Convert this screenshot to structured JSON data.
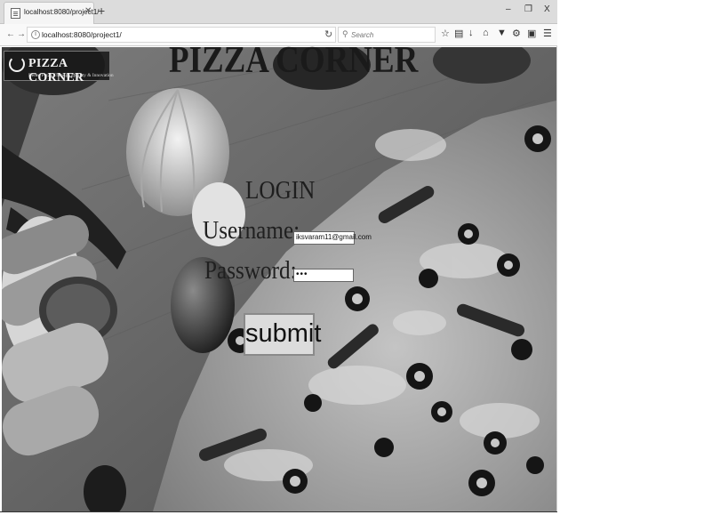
{
  "browser": {
    "tab_title": "localhost:8080/project1/",
    "tab_close": "✕",
    "new_tab": "+",
    "window_controls": {
      "minimize": "–",
      "restore": "❐",
      "close": "X"
    },
    "url": "localhost:8080/project1/",
    "search_placeholder": "Search",
    "icons": [
      "back-icon",
      "forward-icon",
      "info-icon",
      "reload-icon",
      "search-icon",
      "bookmark-star-icon",
      "reading-list-icon",
      "download-icon",
      "home-icon",
      "pocket-icon",
      "extension-icon",
      "sidebar-icon",
      "menu-icon"
    ]
  },
  "page": {
    "logo": {
      "name": "PIZZA CORNER",
      "tagline": "Better Pizza Through Quality & Innovation"
    },
    "title": "PIZZA CORNER",
    "login": {
      "heading": "LOGIN",
      "username_label": "Username:",
      "username_value": "iksvaram11@gmail.com",
      "password_label": "Password:",
      "password_value": "•••",
      "submit_label": "submit"
    }
  },
  "colors": {
    "tabstrip": "#dcdcdc",
    "page_text": "#1a1a1a",
    "button_bg": "#dcdcdc"
  }
}
